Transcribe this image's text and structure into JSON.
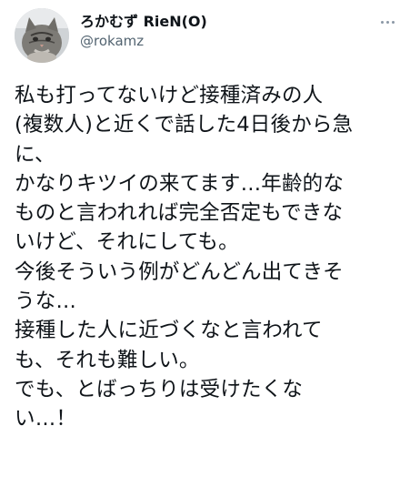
{
  "user": {
    "display_name": "ろかむず RieN(O)",
    "handle": "@rokamz"
  },
  "tweet": {
    "lines": [
      "私も打ってないけど接種済みの人",
      "(複数人)と近くで話した4日後から急",
      "に、",
      "かなりキツイの来てます…年齢的な",
      "ものと言われれば完全否定もできな",
      "いけど、それにしても。",
      "今後そういう例がどんどん出てきそ",
      "うな…",
      "接種した人に近づくなと言われて",
      "も、それも難しい。",
      "でも、とばっちりは受けたくな",
      "い…！"
    ]
  },
  "icons": {
    "more": "more-horizontal-icon",
    "avatar": "cat-avatar"
  },
  "colors": {
    "text": "#0f1419",
    "secondary": "#536471",
    "background": "#ffffff"
  }
}
